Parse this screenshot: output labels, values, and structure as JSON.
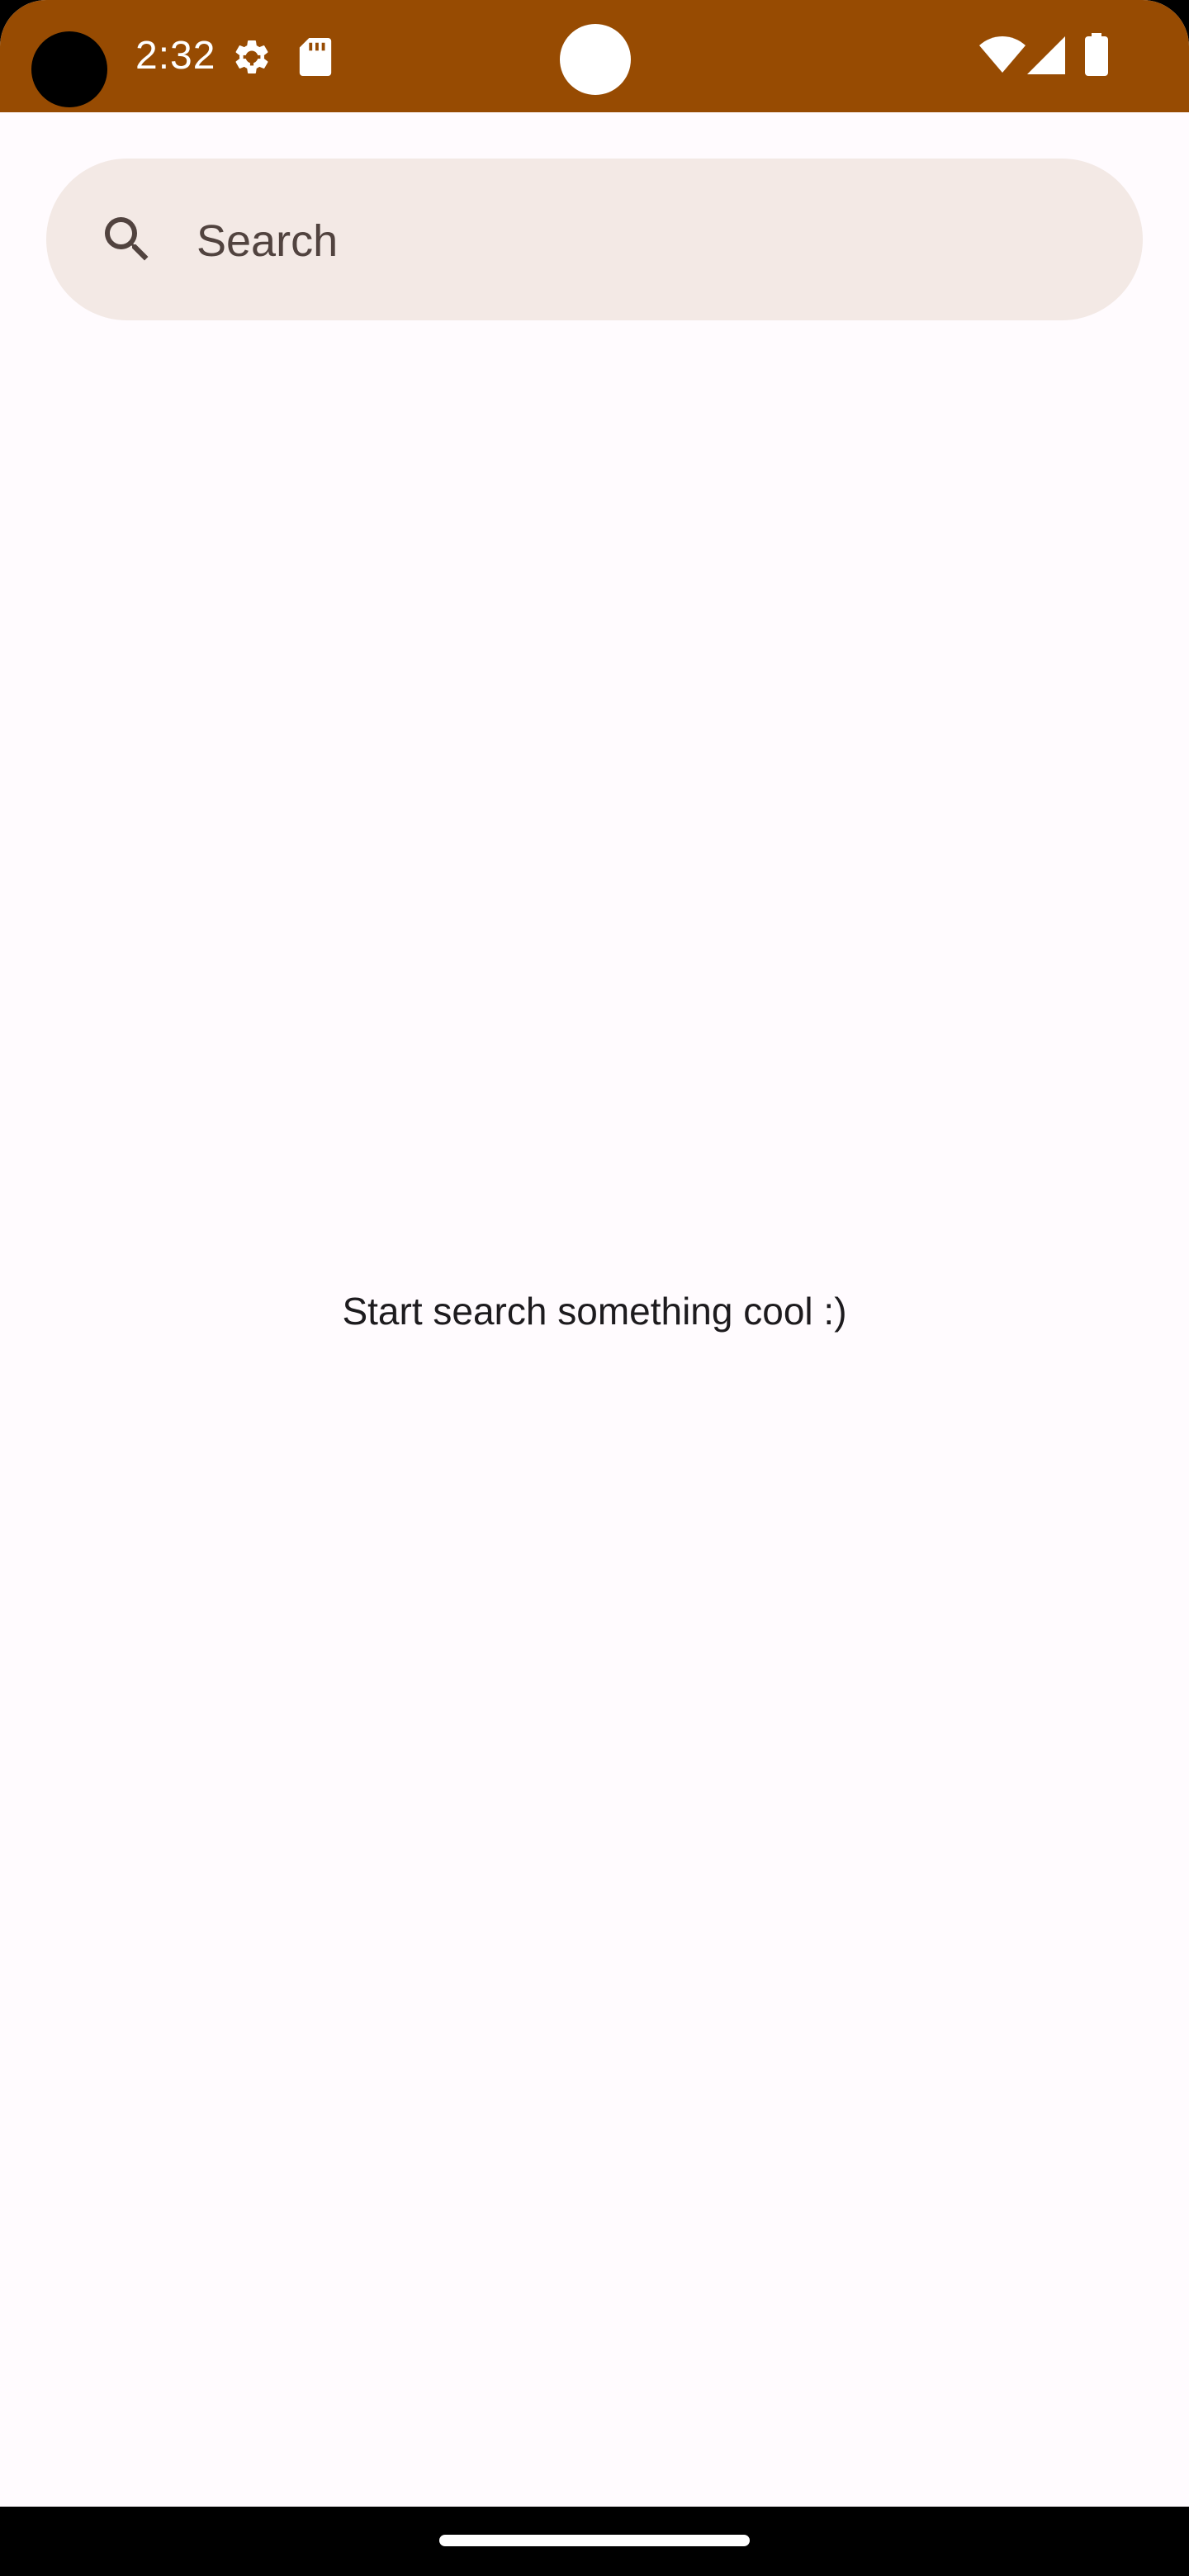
{
  "status_bar": {
    "time": "2:32",
    "background_color": "#974B02",
    "icons": [
      "settings-gear-icon",
      "sd-card-icon",
      "wifi-icon",
      "cellular-signal-icon",
      "battery-icon"
    ]
  },
  "search": {
    "placeholder": "Search",
    "icon": "search-icon",
    "background_color": "#F3E9E5"
  },
  "empty_state": {
    "message": "Start search something cool :)"
  },
  "theme": {
    "surface_color": "#FFFBFE",
    "text_color": "#1D1B1E",
    "placeholder_color": "#51433F"
  }
}
